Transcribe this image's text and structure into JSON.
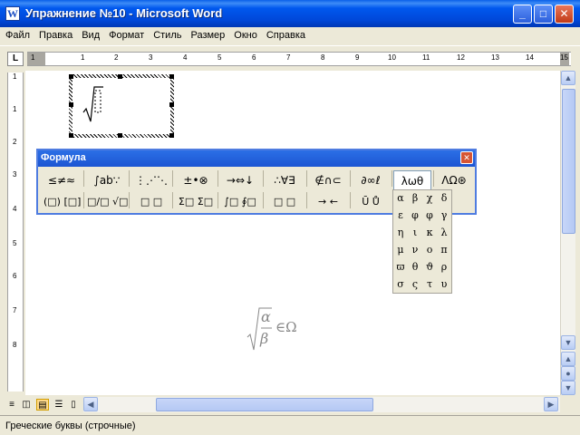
{
  "window": {
    "title": "Упражнение №10 - Microsoft Word"
  },
  "menu": [
    "Файл",
    "Правка",
    "Вид",
    "Формат",
    "Стиль",
    "Размер",
    "Окно",
    "Справка"
  ],
  "ruler": {
    "numbers": [
      "1",
      "1",
      "2",
      "3",
      "4",
      "5",
      "6",
      "7",
      "8",
      "9",
      "10",
      "11",
      "12",
      "13",
      "14",
      "15"
    ]
  },
  "vruler": {
    "numbers": [
      "1",
      "1",
      "2",
      "3",
      "4",
      "5",
      "6",
      "7",
      "8"
    ]
  },
  "formula_toolbar": {
    "title": "Формула",
    "row1": [
      "≤≠≈",
      "∫ab∵",
      "⋮⋰⋱",
      "±•⊗",
      "→⇔↓",
      "∴∀∃",
      "∉∩⊂",
      "∂∞ℓ",
      "λωθ",
      "ΛΩ⊛"
    ],
    "row2": [
      "(□) [□]",
      "□/□ √□",
      "□ □",
      "Σ□ Σ□",
      "∫□ ∮□",
      "□ □",
      "→ ←",
      "Ū Ů"
    ]
  },
  "greek_palette": [
    "α",
    "β",
    "χ",
    "δ",
    "ε",
    "φ",
    "φ",
    "γ",
    "η",
    "ι",
    "κ",
    "λ",
    "μ",
    "ν",
    "ο",
    "π",
    "ϖ",
    "θ",
    "ϑ",
    "ρ",
    "σ",
    "ς",
    "τ",
    "υ"
  ],
  "equation": {
    "numerator": "α",
    "denominator": "β",
    "rest": "∈Ω"
  },
  "status": {
    "text": "Греческие буквы (строчные)"
  },
  "icons": {
    "app": "word-icon",
    "close": "close-icon"
  }
}
